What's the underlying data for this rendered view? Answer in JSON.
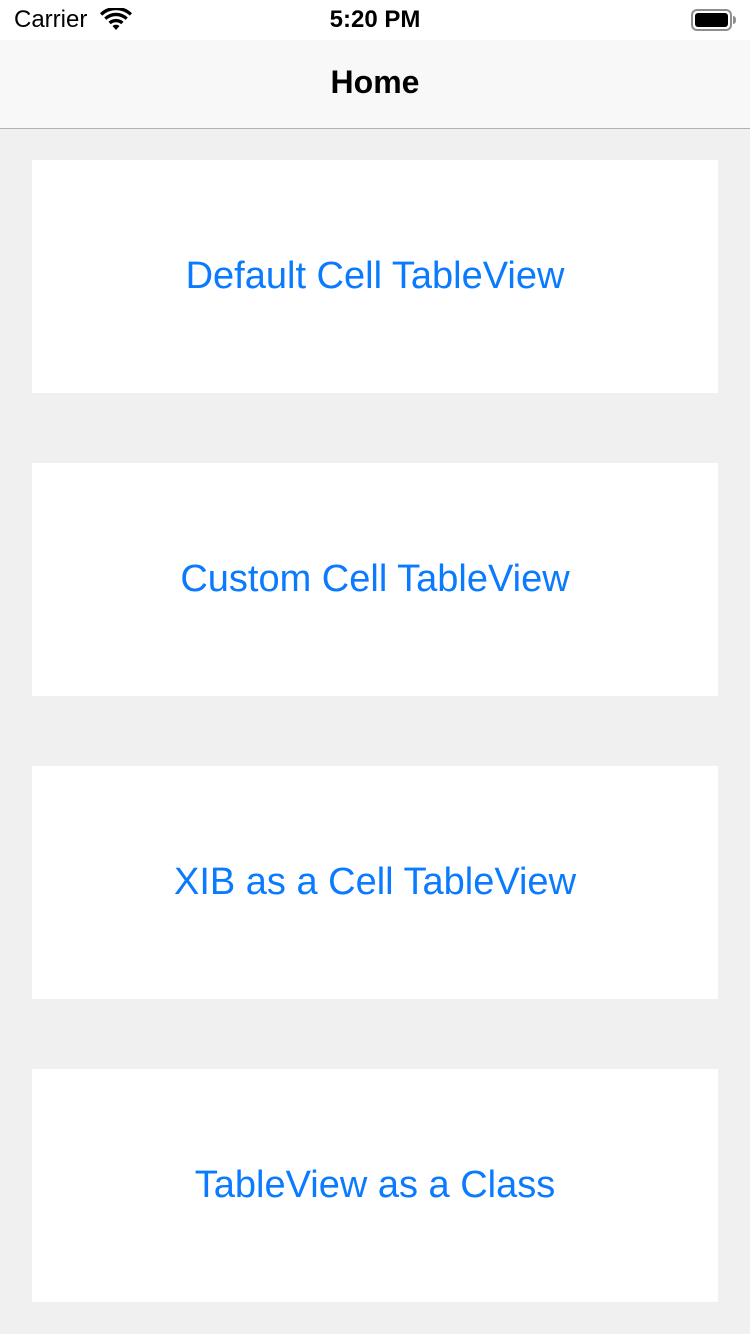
{
  "status_bar": {
    "carrier": "Carrier",
    "time": "5:20 PM",
    "wifi_icon": "wifi-icon",
    "battery_icon": "battery-icon"
  },
  "nav_bar": {
    "title": "Home"
  },
  "buttons": [
    {
      "label": "Default Cell TableView"
    },
    {
      "label": "Custom Cell TableView"
    },
    {
      "label": "XIB as a Cell TableView"
    },
    {
      "label": "TableView as a Class"
    }
  ],
  "colors": {
    "accent": "#0a7aff",
    "background": "#f0f0f0",
    "card": "#ffffff"
  }
}
